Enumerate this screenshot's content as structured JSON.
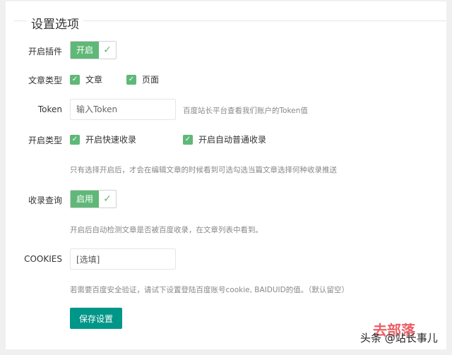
{
  "section_title": "设置选项",
  "plugin": {
    "label": "开启插件",
    "switch_text": "开启",
    "enabled": true
  },
  "article_type": {
    "label": "文章类型",
    "options": [
      {
        "label": "文章",
        "checked": true
      },
      {
        "label": "页面",
        "checked": true
      }
    ]
  },
  "token": {
    "label": "Token",
    "placeholder": "输入Token",
    "hint": "百度站长平台查看我们账户的Token值"
  },
  "open_type": {
    "label": "开启类型",
    "options": [
      {
        "label": "开启快速收录",
        "checked": true
      },
      {
        "label": "开启自动普通收录",
        "checked": true
      }
    ],
    "hint": "只有选择开启后，才会在编辑文章的时候看到可选勾选当篇文章选择何种收录推送"
  },
  "query": {
    "label": "收录查询",
    "switch_text": "启用",
    "enabled": true,
    "hint": "开启后自动检测文章是否被百度收录，在文章列表中看到。"
  },
  "cookies": {
    "label": "COOKIES",
    "value": "[选填]",
    "hint": "若需要百度安全验证，请试下设置登陆百度账号cookie, BAIDUID的值。（默认留空）"
  },
  "save_label": "保存设置",
  "watermark": {
    "text": "头条 @站长事儿",
    "red_text": "去部落"
  },
  "colors": {
    "switch": "#5fb878",
    "button": "#009688"
  }
}
